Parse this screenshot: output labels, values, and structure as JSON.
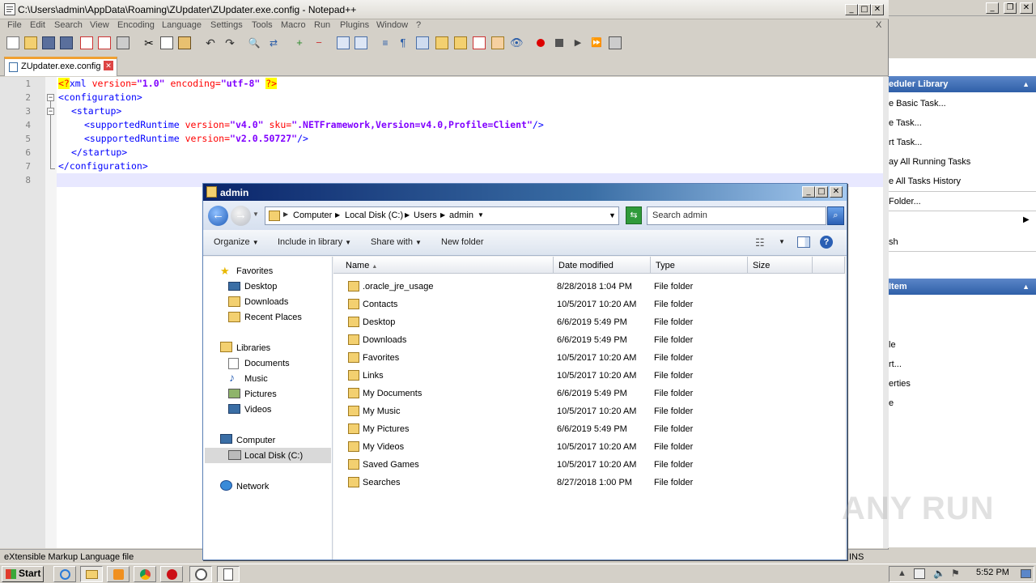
{
  "notepad": {
    "title": "C:\\Users\\admin\\AppData\\Roaming\\ZUpdater\\ZUpdater.exe.config - Notepad++",
    "menu": [
      "File",
      "Edit",
      "Search",
      "View",
      "Encoding",
      "Language",
      "Settings",
      "Tools",
      "Macro",
      "Run",
      "Plugins",
      "Window",
      "?"
    ],
    "close_x": "X",
    "tab_label": "ZUpdater.exe.config",
    "line_numbers": [
      "1",
      "2",
      "3",
      "4",
      "5",
      "6",
      "7",
      "8"
    ],
    "code": {
      "l1_pi_open": "<?",
      "l1_tag": "xml",
      "l1_attr1": " version=",
      "l1_val1": "\"1.0\"",
      "l1_attr2": " encoding=",
      "l1_val2": "\"utf-8\"",
      "l1_pi_close": "?>",
      "l2": "<configuration>",
      "l3": "<startup>",
      "l4_tag": "<supportedRuntime",
      "l4_attr1": " version=",
      "l4_val1": "\"v4.0\"",
      "l4_attr2": " sku=",
      "l4_val2": "\".NETFramework,Version=v4.0,Profile=Client\"",
      "l4_end": "/>",
      "l5_tag": "<supportedRuntime",
      "l5_attr1": " version=",
      "l5_val1": "\"v2.0.50727\"",
      "l5_end": "/>",
      "l6": "</startup>",
      "l7": "</configuration>"
    },
    "status_left": "eXtensible Markup Language file",
    "status_right": "INS"
  },
  "task_scheduler": {
    "section1": "eduler Library",
    "items1": [
      "e Basic Task...",
      "e Task...",
      "rt Task...",
      "ay All Running Tasks",
      "e All Tasks History",
      "Folder...",
      "",
      "sh"
    ],
    "section2": "Item",
    "items2": [
      "le",
      "rt...",
      "erties",
      "e"
    ]
  },
  "explorer": {
    "title": "admin",
    "breadcrumb": [
      "Computer",
      "Local Disk (C:)",
      "Users",
      "admin"
    ],
    "search_placeholder": "Search admin",
    "commands": [
      "Organize",
      "Include in library",
      "Share with",
      "New folder"
    ],
    "nav": {
      "favorites": "Favorites",
      "fav_items": [
        "Desktop",
        "Downloads",
        "Recent Places"
      ],
      "libraries": "Libraries",
      "lib_items": [
        "Documents",
        "Music",
        "Pictures",
        "Videos"
      ],
      "computer": "Computer",
      "computer_items": [
        "Local Disk (C:)"
      ],
      "network": "Network"
    },
    "columns": [
      "Name",
      "Date modified",
      "Type",
      "Size"
    ],
    "rows": [
      {
        "name": ".oracle_jre_usage",
        "date": "8/28/2018 1:04 PM",
        "type": "File folder"
      },
      {
        "name": "Contacts",
        "date": "10/5/2017 10:20 AM",
        "type": "File folder"
      },
      {
        "name": "Desktop",
        "date": "6/6/2019 5:49 PM",
        "type": "File folder"
      },
      {
        "name": "Downloads",
        "date": "6/6/2019 5:49 PM",
        "type": "File folder"
      },
      {
        "name": "Favorites",
        "date": "10/5/2017 10:20 AM",
        "type": "File folder"
      },
      {
        "name": "Links",
        "date": "10/5/2017 10:20 AM",
        "type": "File folder"
      },
      {
        "name": "My Documents",
        "date": "6/6/2019 5:49 PM",
        "type": "File folder"
      },
      {
        "name": "My Music",
        "date": "10/5/2017 10:20 AM",
        "type": "File folder"
      },
      {
        "name": "My Pictures",
        "date": "6/6/2019 5:49 PM",
        "type": "File folder"
      },
      {
        "name": "My Videos",
        "date": "10/5/2017 10:20 AM",
        "type": "File folder"
      },
      {
        "name": "Saved Games",
        "date": "10/5/2017 10:20 AM",
        "type": "File folder"
      },
      {
        "name": "Searches",
        "date": "8/27/2018 1:00 PM",
        "type": "File folder"
      }
    ]
  },
  "taskbar": {
    "start_label": "Start",
    "clock": "5:52 PM"
  },
  "watermark": "ANY RUN",
  "colors": {
    "title_gradient_start": "#0a246a",
    "section_blue": "#2f5fa8",
    "xml_tag": "#0000ff",
    "xml_attr": "#ff0000",
    "xml_value": "#8000ff",
    "pi_highlight": "#ffff00"
  }
}
